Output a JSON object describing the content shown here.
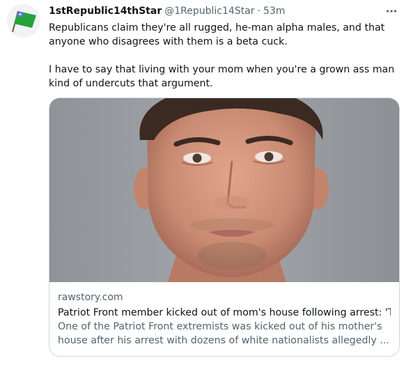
{
  "tweet": {
    "avatar_icon": "green-flag-icon",
    "display_name": "1stRepublic14thStar",
    "handle": "@1Republic14Star",
    "separator": "·",
    "time": "53m",
    "more_icon": "more-options-icon",
    "text_paragraphs": [
      "Republicans claim they're all rugged, he-man alpha males, and that anyone who disagrees with them is a beta cuck.",
      "I have to say that living with your mom when you're a grown ass man kind of undercuts that argument."
    ]
  },
  "card": {
    "image_icon": "mugshot-photo",
    "domain": "rawstory.com",
    "title": "Patriot Front member kicked out of mom's house following arrest: 'Thi...",
    "description": "One of the Patriot Front extremists was kicked out of his mother's house after his arrest with dozens of white nationalists allegedly ..."
  },
  "colors": {
    "text_primary": "#0f1419",
    "text_secondary": "#536471",
    "card_border": "#cfd9de",
    "flag_green": "#23a33a"
  }
}
